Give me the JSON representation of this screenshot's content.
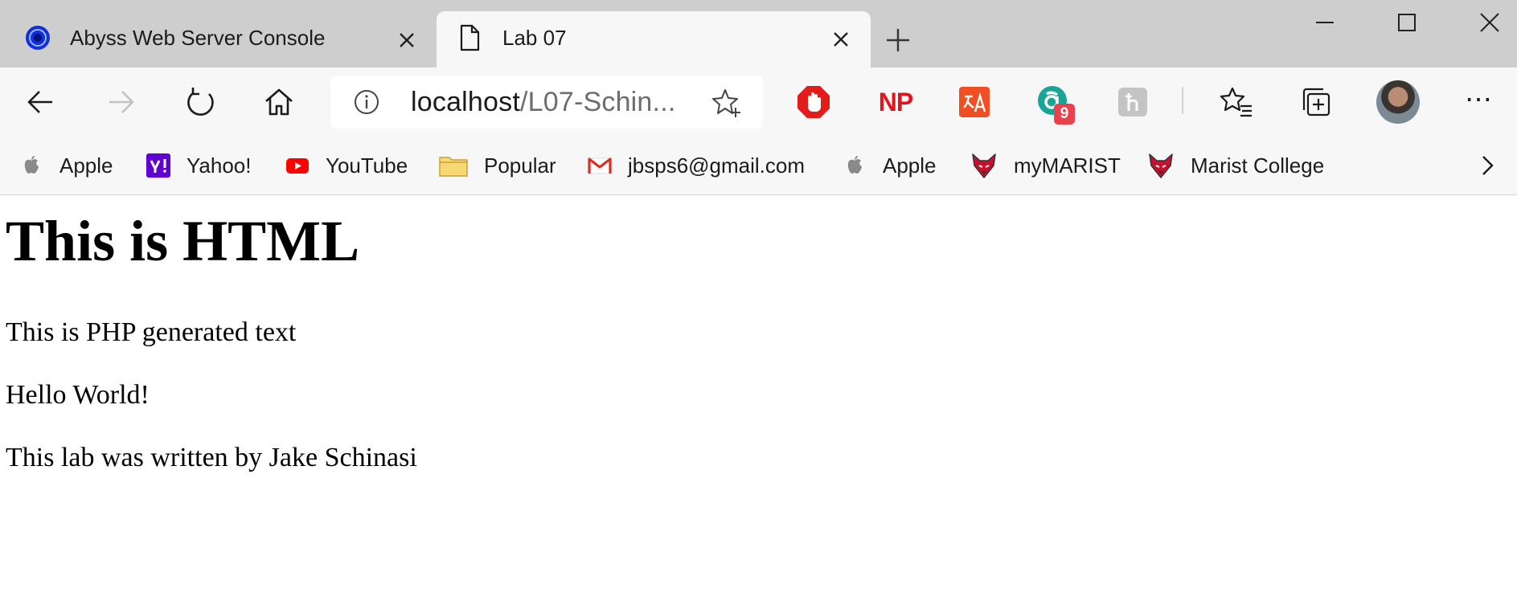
{
  "tabs": [
    {
      "title": "Abyss Web Server Console",
      "icon": "abyss-favicon",
      "active": false
    },
    {
      "title": "Lab 07",
      "icon": "page-icon",
      "active": true
    }
  ],
  "address_bar": {
    "host": "localhost",
    "path": "/L07-Schin..."
  },
  "extensions": [
    {
      "name": "adblock-icon",
      "label": ""
    },
    {
      "name": "np-extension-icon",
      "label": "NP"
    },
    {
      "name": "translate-extension-icon",
      "label": ""
    },
    {
      "name": "a-extension-icon",
      "label": "",
      "badge": "9"
    },
    {
      "name": "honey-extension-icon",
      "label": ""
    }
  ],
  "bookmarks": [
    {
      "label": "Apple",
      "icon": "apple-icon"
    },
    {
      "label": "Yahoo!",
      "icon": "yahoo-icon"
    },
    {
      "label": "YouTube",
      "icon": "youtube-icon"
    },
    {
      "label": "Popular",
      "icon": "folder-icon"
    },
    {
      "label": "jbsps6@gmail.com",
      "icon": "gmail-icon"
    },
    {
      "label": "Apple",
      "icon": "apple-icon"
    },
    {
      "label": "myMARIST",
      "icon": "marist-fox-icon"
    },
    {
      "label": "Marist College",
      "icon": "marist-fox-icon"
    }
  ],
  "page": {
    "heading": "This is HTML",
    "paragraphs": [
      "This is PHP generated text",
      "Hello World!",
      "This lab was written by Jake Schinasi"
    ]
  },
  "colors": {
    "tabstrip_bg": "#cecece",
    "toolbar_bg": "#f7f7f7",
    "adblock_red": "#e21b1b",
    "np_red": "#e0161e",
    "youtube_red": "#ff0000",
    "yahoo_purple": "#6001d2"
  }
}
